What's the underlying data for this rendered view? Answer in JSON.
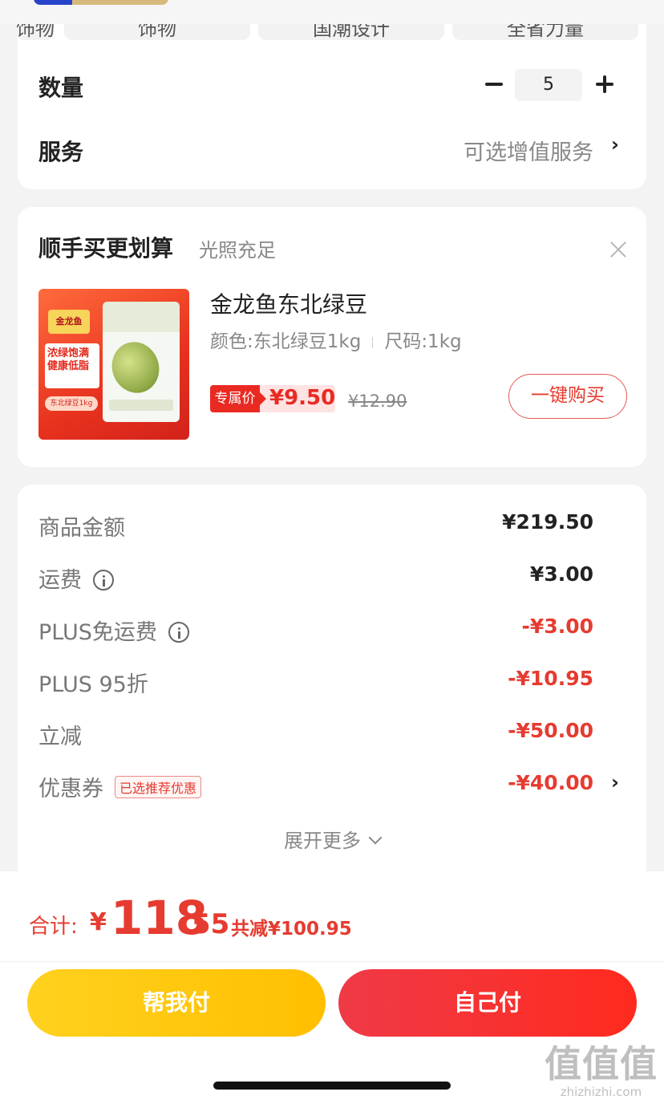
{
  "spec_chips": [
    "饰物",
    "国潮设计",
    "全省力量"
  ],
  "quantity": {
    "label": "数量",
    "value": "5"
  },
  "service": {
    "label": "服务",
    "value": "可选增值服务",
    "chevron": "›"
  },
  "bundle": {
    "title": "顺手买更划算",
    "subtitle": "光照充足",
    "product": {
      "name": "金龙鱼东北绿豆",
      "color_attr": "颜色:东北绿豆1kg",
      "size_attr": "尺码:1kg",
      "price_tag": "专属价",
      "price": "¥9.50",
      "original_price": "¥12.90",
      "buy_label": "一键购买",
      "image": {
        "brand": "金龙鱼",
        "slogan": "浓绿饱满 健康低脂",
        "tag": "东北绿豆1kg"
      }
    }
  },
  "amounts": [
    {
      "label": "商品金额",
      "value": "¥219.50",
      "info": false,
      "red": false
    },
    {
      "label": "运费",
      "value": "¥3.00",
      "info": true,
      "red": false
    },
    {
      "label": "PLUS免运费",
      "value": "-¥3.00",
      "info": true,
      "red": true
    },
    {
      "label": "PLUS 95折",
      "value": "-¥10.95",
      "info": false,
      "red": true
    },
    {
      "label": "立减",
      "value": "-¥50.00",
      "info": false,
      "red": true
    },
    {
      "label": "优惠券",
      "value": "-¥40.00",
      "info": false,
      "red": true,
      "badge": "已选推荐优惠"
    }
  ],
  "expand_label": "展开更多",
  "total": {
    "label": "合计:",
    "yen": "¥",
    "integer": "118",
    "decimal": ".55",
    "savings": "共减¥100.95"
  },
  "buttons": {
    "help_pay": "帮我付",
    "self_pay": "自己付"
  },
  "watermark": {
    "logo": "值值值",
    "url": "zhizhizhi.com"
  },
  "colors": {
    "accent_red": "#e63b30",
    "yellow": "#ffc400",
    "background": "#f3f3f3"
  }
}
